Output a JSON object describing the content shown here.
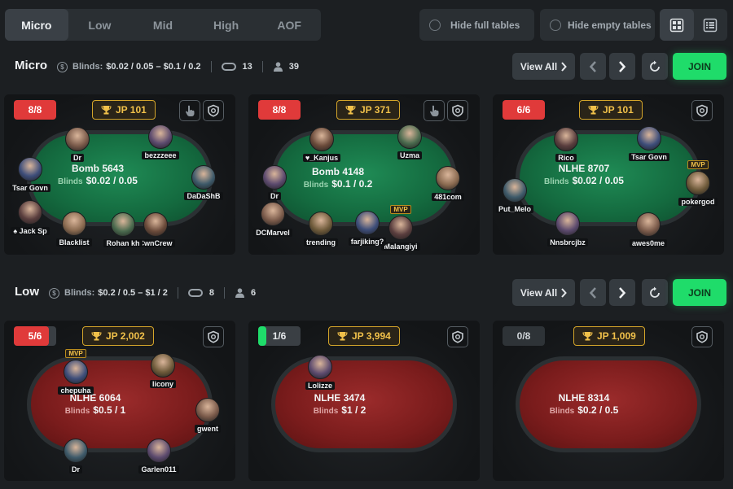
{
  "stake_tabs": [
    "Micro",
    "Low",
    "Mid",
    "High",
    "AOF"
  ],
  "active_tab": "Micro",
  "filters": {
    "hide_full": "Hide full tables",
    "hide_empty": "Hide empty tables"
  },
  "view_modes": {
    "grid_icon": "grid-view-icon",
    "list_icon": "list-view-icon"
  },
  "colors": {
    "join": "#1fdc6a",
    "seats_full": "#e03a3a",
    "jackpot": "#d4a52a",
    "felt_green": "#146a3f",
    "felt_red": "#7a1c1c"
  },
  "sections": [
    {
      "title": "Micro",
      "blinds_label": "Blinds:",
      "blinds_value": "$0.02 / 0.05 – $0.1 / 0.2",
      "tables_count": "13",
      "players_count": "39",
      "view_all": "View All",
      "join": "JOIN",
      "tables": [
        {
          "seats": "8/8",
          "jackpot": "JP 101",
          "name": "Bomb 5643",
          "blinds_label": "Blinds",
          "stakes": "$0.02 / 0.05",
          "players": [
            {
              "name": "Dr"
            },
            {
              "name": "bezzzeee"
            },
            {
              "name": "DaDaShB"
            },
            {
              "name": "CwnCrew"
            },
            {
              "name": "Rohan kh"
            },
            {
              "name": "Blacklist"
            },
            {
              "name": "♠ Jack Sp"
            },
            {
              "name": "Tsar Govn"
            }
          ]
        },
        {
          "seats": "8/8",
          "jackpot": "JP 371",
          "name": "Bomb 4148",
          "blinds_label": "Blinds",
          "stakes": "$0.1 / 0.2",
          "players": [
            {
              "name": "♥_Kanjus"
            },
            {
              "name": "Uzma"
            },
            {
              "name": "481com"
            },
            {
              "name": "Malangiyi",
              "badge": "MVP"
            },
            {
              "name": "farjiking?"
            },
            {
              "name": "trending"
            },
            {
              "name": "DCMarvel"
            },
            {
              "name": "Dr"
            }
          ]
        },
        {
          "seats": "6/6",
          "jackpot": "JP 101",
          "name": "NLHE 8707",
          "blinds_label": "Blinds",
          "stakes": "$0.02 / 0.05",
          "players": [
            {
              "name": "Rico"
            },
            {
              "name": "Tsar Govn"
            },
            {
              "name": "pokergod",
              "badge": "MVP"
            },
            {
              "name": "awes0me"
            },
            {
              "name": "Nnsbrcjbz"
            },
            {
              "name": "Put_Melo"
            }
          ]
        }
      ]
    },
    {
      "title": "Low",
      "blinds_label": "Blinds:",
      "blinds_value": "$0.2 / 0.5 – $1 / 2",
      "tables_count": "8",
      "players_count": "6",
      "view_all": "View All",
      "join": "JOIN",
      "tables": [
        {
          "seats": "5/6",
          "seats_fill": 0.83,
          "jackpot": "JP 2,002",
          "name": "NLHE 6064",
          "blinds_label": "Blinds",
          "stakes": "$0.5 / 1",
          "players": [
            {
              "name": "chepuha",
              "badge": "MVP"
            },
            {
              "name": "licony"
            },
            {
              "name": "gwent"
            },
            {
              "name": "Garlen011"
            },
            {
              "name": "Dr"
            }
          ]
        },
        {
          "seats": "1/6",
          "seats_fill": 0.17,
          "jackpot": "JP 3,994",
          "name": "NLHE 3474",
          "blinds_label": "Blinds",
          "stakes": "$1 / 2",
          "players": [
            {
              "name": "Lolizze"
            }
          ]
        },
        {
          "seats": "0/8",
          "seats_fill": 0,
          "jackpot": "JP 1,009",
          "name": "NLHE 8314",
          "blinds_label": "Blinds",
          "stakes": "$0.2 / 0.5",
          "players": []
        }
      ]
    }
  ]
}
